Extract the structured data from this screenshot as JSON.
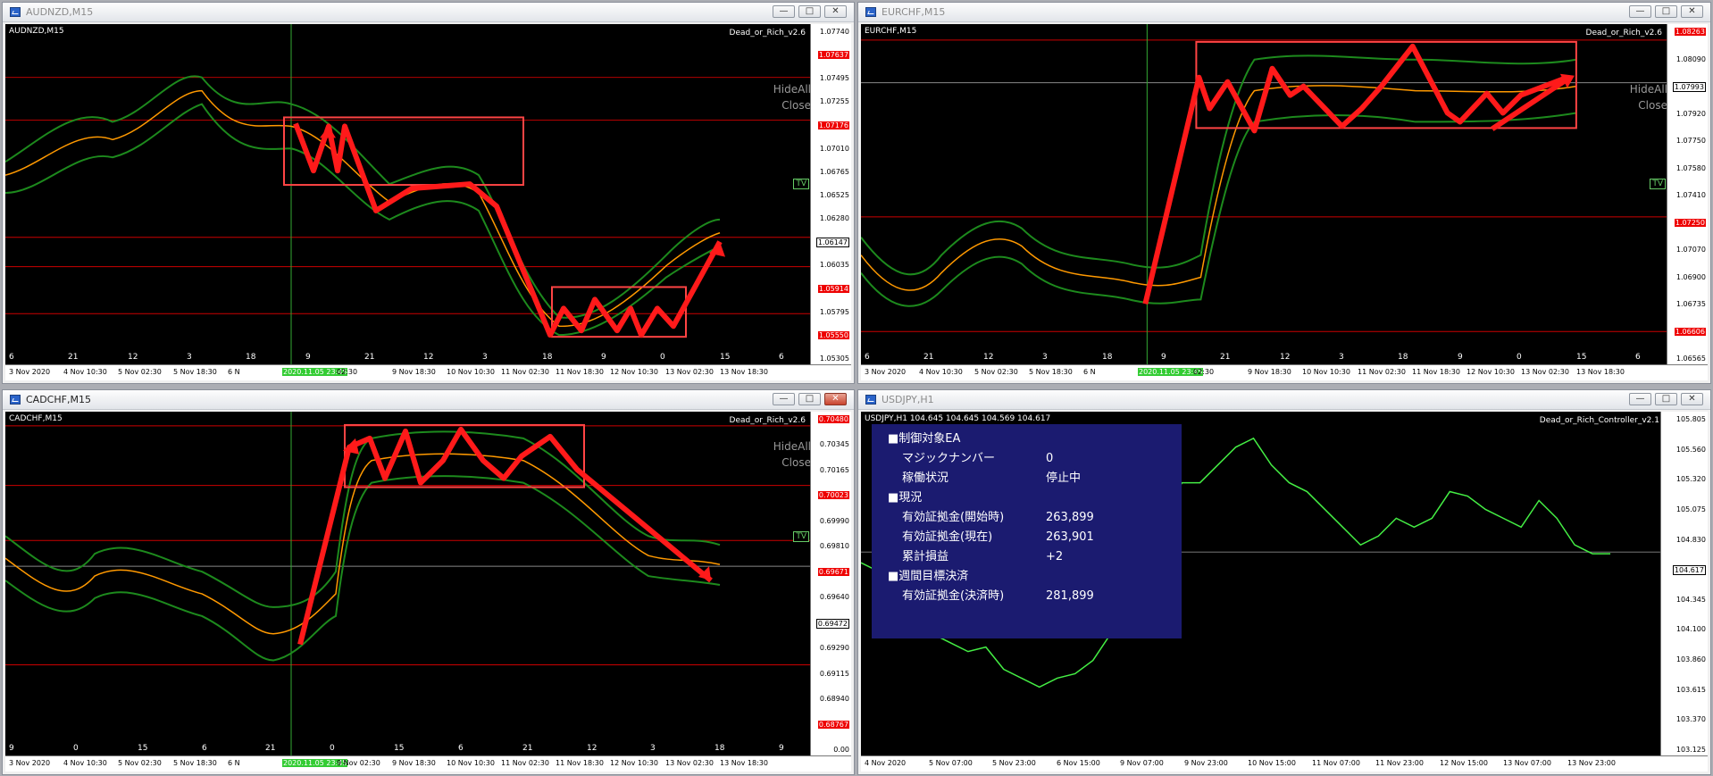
{
  "windows": [
    {
      "key": "audnzd",
      "title": "AUDNZD,M15",
      "symbol_label": "AUDNZD,M15",
      "ea_label": "Dead_or_Rich_v2.6",
      "hide_all": "HideAll",
      "close_text": "Close",
      "tv_badge": "TV",
      "price_labels": [
        {
          "text": "1.07740",
          "style": "plain"
        },
        {
          "text": "1.07637",
          "style": "red"
        },
        {
          "text": "1.07495",
          "style": "plain"
        },
        {
          "text": "1.07255",
          "style": "plain"
        },
        {
          "text": "1.07176",
          "style": "red"
        },
        {
          "text": "1.07010",
          "style": "plain"
        },
        {
          "text": "1.06765",
          "style": "plain"
        },
        {
          "text": "1.06525",
          "style": "plain"
        },
        {
          "text": "1.06280",
          "style": "plain"
        },
        {
          "text": "1.06147",
          "style": "cur"
        },
        {
          "text": "1.06035",
          "style": "plain"
        },
        {
          "text": "1.05914",
          "style": "red"
        },
        {
          "text": "1.05795",
          "style": "plain"
        },
        {
          "text": "1.05550",
          "style": "red"
        },
        {
          "text": "1.05305",
          "style": "plain"
        }
      ],
      "hour_labels": [
        "6",
        "21",
        "12",
        "3",
        "18",
        "9",
        "21",
        "12",
        "3",
        "18",
        "9",
        "0",
        "15",
        "6"
      ],
      "date_labels": [
        "3 Nov 2020",
        "4 Nov 10:30",
        "5 Nov 02:30",
        "5 Nov 18:30",
        "6 N",
        "2020.11.05 23:45",
        "02:30",
        "9 Nov 18:30",
        "10 Nov 10:30",
        "11 Nov 02:30",
        "11 Nov 18:30",
        "12 Nov 10:30",
        "13 Nov 02:30",
        "13 Nov 18:30"
      ]
    },
    {
      "key": "eurchf",
      "title": "EURCHF,M15",
      "symbol_label": "EURCHF,M15",
      "ea_label": "Dead_or_Rich_v2.6",
      "hide_all": "HideAll",
      "close_text": "Close",
      "tv_badge": "TV",
      "price_labels": [
        {
          "text": "1.08263",
          "style": "red"
        },
        {
          "text": "1.08090",
          "style": "plain"
        },
        {
          "text": "1.07993",
          "style": "cur"
        },
        {
          "text": "1.07920",
          "style": "plain"
        },
        {
          "text": "1.07750",
          "style": "plain"
        },
        {
          "text": "1.07580",
          "style": "plain"
        },
        {
          "text": "1.07410",
          "style": "plain"
        },
        {
          "text": "1.07250",
          "style": "red"
        },
        {
          "text": "1.07070",
          "style": "plain"
        },
        {
          "text": "1.06900",
          "style": "plain"
        },
        {
          "text": "1.06735",
          "style": "plain"
        },
        {
          "text": "1.06606",
          "style": "red"
        },
        {
          "text": "1.06565",
          "style": "plain"
        }
      ],
      "hour_labels": [
        "6",
        "21",
        "12",
        "3",
        "18",
        "9",
        "21",
        "12",
        "3",
        "18",
        "9",
        "0",
        "15",
        "6"
      ],
      "date_labels": [
        "3 Nov 2020",
        "4 Nov 10:30",
        "5 Nov 02:30",
        "5 Nov 18:30",
        "6 N",
        "2020.11.05 23:45",
        "02:30",
        "9 Nov 18:30",
        "10 Nov 10:30",
        "11 Nov 02:30",
        "11 Nov 18:30",
        "12 Nov 10:30",
        "13 Nov 02:30",
        "13 Nov 18:30"
      ]
    },
    {
      "key": "cadchf",
      "title": "CADCHF,M15",
      "symbol_label": "CADCHF,M15",
      "ea_label": "Dead_or_Rich_v2.6",
      "hide_all": "HideAll",
      "close_text": "Close",
      "tv_badge": "TV",
      "price_labels": [
        {
          "text": "0.70480",
          "style": "red"
        },
        {
          "text": "0.70345",
          "style": "plain"
        },
        {
          "text": "0.70165",
          "style": "plain"
        },
        {
          "text": "0.70023",
          "style": "red"
        },
        {
          "text": "0.69990",
          "style": "plain"
        },
        {
          "text": "0.69810",
          "style": "plain"
        },
        {
          "text": "0.69671",
          "style": "red"
        },
        {
          "text": "0.69640",
          "style": "plain"
        },
        {
          "text": "0.69472",
          "style": "cur"
        },
        {
          "text": "0.69290",
          "style": "plain"
        },
        {
          "text": "0.69115",
          "style": "plain"
        },
        {
          "text": "0.68940",
          "style": "plain"
        },
        {
          "text": "0.68767",
          "style": "red"
        },
        {
          "text": "0.00",
          "style": "plain"
        }
      ],
      "hour_labels": [
        "9",
        "0",
        "15",
        "6",
        "21",
        "0",
        "15",
        "6",
        "21",
        "12",
        "3",
        "18",
        "9"
      ],
      "date_labels": [
        "3 Nov 2020",
        "4 Nov 10:30",
        "5 Nov 02:30",
        "5 Nov 18:30",
        "6 N",
        "2020.11.05 23:45",
        "9 Nov 02:30",
        "9 Nov 18:30",
        "10 Nov 10:30",
        "11 Nov 02:30",
        "11 Nov 18:30",
        "12 Nov 10:30",
        "13 Nov 02:30",
        "13 Nov 18:30"
      ]
    },
    {
      "key": "usdjpy",
      "title": "USDJPY,H1",
      "symbol_label": "USDJPY,H1  104.645 104.645 104.569 104.617",
      "ea_label": "Dead_or_Rich_Controller_v2.1",
      "price_labels": [
        {
          "text": "105.805",
          "style": "plain"
        },
        {
          "text": "105.560",
          "style": "plain"
        },
        {
          "text": "105.320",
          "style": "plain"
        },
        {
          "text": "105.075",
          "style": "plain"
        },
        {
          "text": "104.830",
          "style": "plain"
        },
        {
          "text": "104.617",
          "style": "cur"
        },
        {
          "text": "104.345",
          "style": "plain"
        },
        {
          "text": "104.100",
          "style": "plain"
        },
        {
          "text": "103.860",
          "style": "plain"
        },
        {
          "text": "103.615",
          "style": "plain"
        },
        {
          "text": "103.370",
          "style": "plain"
        },
        {
          "text": "103.125",
          "style": "plain"
        }
      ],
      "date_labels": [
        "4 Nov 2020",
        "5 Nov 07:00",
        "5 Nov 23:00",
        "6 Nov 15:00",
        "9 Nov 07:00",
        "9 Nov 23:00",
        "10 Nov 15:00",
        "11 Nov 07:00",
        "11 Nov 23:00",
        "12 Nov 15:00",
        "13 Nov 07:00",
        "13 Nov 23:00"
      ],
      "panel": {
        "rows": [
          {
            "label": "■制御対象EA",
            "value": "",
            "indent": 0
          },
          {
            "label": "マジックナンバー",
            "value": "0",
            "indent": 1
          },
          {
            "label": "稼働状況",
            "value": "停止中",
            "indent": 1
          },
          {
            "label": "■現況",
            "value": "",
            "indent": 0
          },
          {
            "label": "有効証拠金(開始時)",
            "value": "263,899",
            "indent": 1
          },
          {
            "label": "有効証拠金(現在)",
            "value": "263,901",
            "indent": 1
          },
          {
            "label": "累計損益",
            "value": "+2",
            "indent": 1
          },
          {
            "label": "■週間目標決済",
            "value": "",
            "indent": 0
          },
          {
            "label": "有効証拠金(決済時)",
            "value": "281,899",
            "indent": 1
          }
        ]
      }
    }
  ],
  "colors": {
    "red_arrow": "#ff1a1a",
    "band": "#1d8a1d",
    "candle_up": "#33cc33",
    "ma": "#ff9900"
  }
}
